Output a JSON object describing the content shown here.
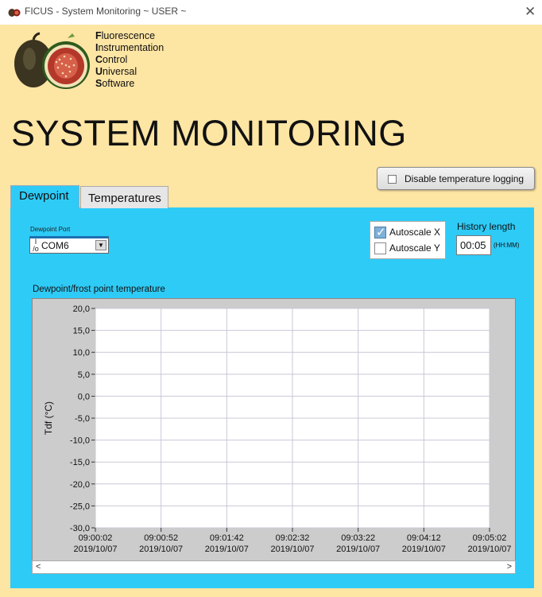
{
  "window": {
    "title": "FICUS - System Monitoring ~ USER ~",
    "close_icon": "close-icon"
  },
  "acronym": [
    {
      "initial": "F",
      "rest": "luorescence"
    },
    {
      "initial": "I",
      "rest": "nstrumentation"
    },
    {
      "initial": "C",
      "rest": "ontrol"
    },
    {
      "initial": "U",
      "rest": "niversal"
    },
    {
      "initial": "S",
      "rest": "oftware"
    }
  ],
  "main_title": "SYSTEM MONITORING",
  "log_button": {
    "label": "Disable temperature logging",
    "checked": false
  },
  "tabs": [
    {
      "label": "Dewpoint",
      "active": true
    },
    {
      "label": "Temperatures",
      "active": false
    }
  ],
  "port": {
    "label": "Dewpoint Port",
    "icon_text": "I/O",
    "value": "COM6"
  },
  "autoscale": {
    "x_label": "Autoscale X",
    "x_checked": true,
    "y_label": "Autoscale Y",
    "y_checked": false
  },
  "history": {
    "label": "History length",
    "value": "00:05",
    "unit": "(HH:MM)"
  },
  "colors": {
    "background": "#fde5a4",
    "panel": "#2ecbf7",
    "plot_bg": "#ffffff",
    "frame": "#cccccc"
  },
  "chart_data": {
    "type": "line",
    "title": "Dewpoint/frost point temperature",
    "ylabel": "Tdf (°C)",
    "xlabel": "",
    "ylim": [
      -30,
      20
    ],
    "y_ticks": [
      "20,0",
      "15,0",
      "10,0",
      "5,0",
      "0,0",
      "-5,0",
      "-10,0",
      "-15,0",
      "-20,0",
      "-25,0",
      "-30,0"
    ],
    "x_ticks": [
      {
        "time": "09:00:02",
        "date": "2019/10/07"
      },
      {
        "time": "09:00:52",
        "date": "2019/10/07"
      },
      {
        "time": "09:01:42",
        "date": "2019/10/07"
      },
      {
        "time": "09:02:32",
        "date": "2019/10/07"
      },
      {
        "time": "09:03:22",
        "date": "2019/10/07"
      },
      {
        "time": "09:04:12",
        "date": "2019/10/07"
      },
      {
        "time": "09:05:02",
        "date": "2019/10/07"
      }
    ],
    "grid": true,
    "series": []
  }
}
